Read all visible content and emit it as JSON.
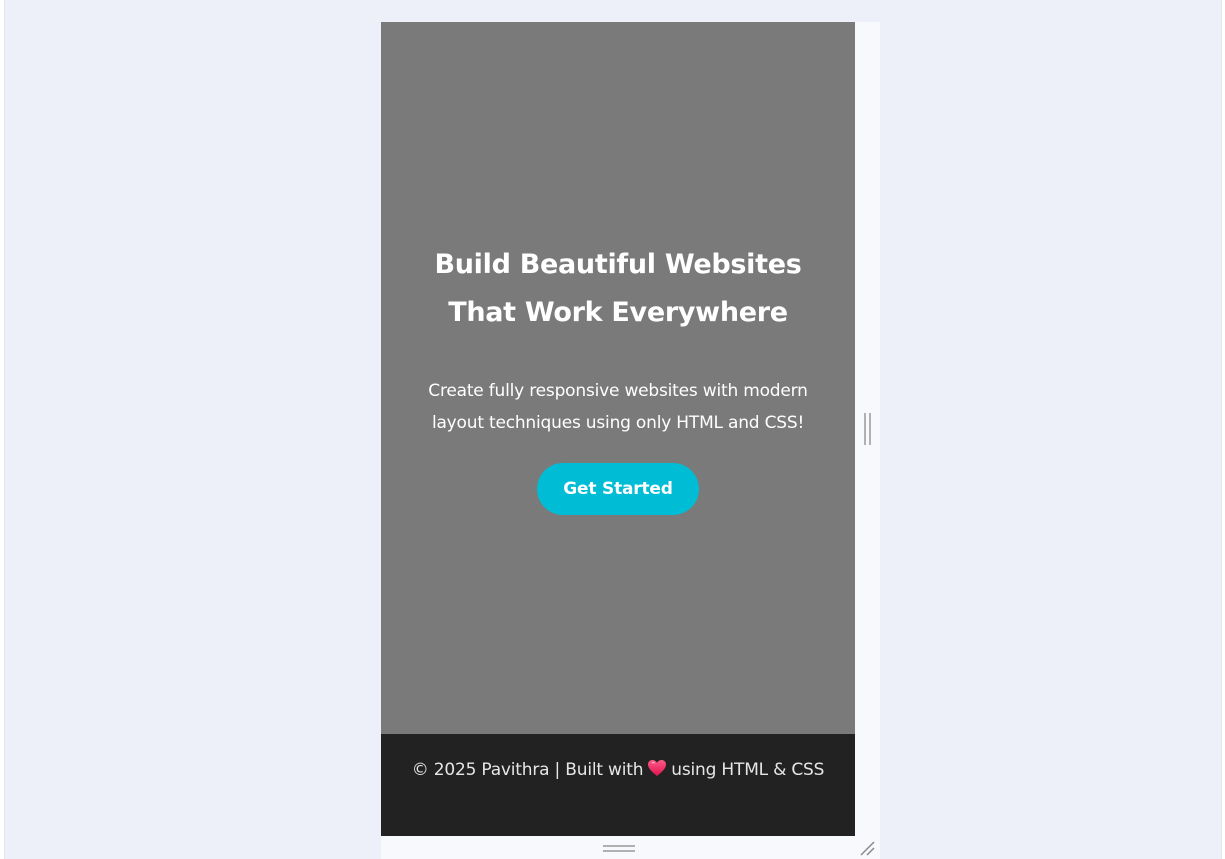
{
  "hero": {
    "title": "Build Beautiful Websites That Work Everywhere",
    "subtitle": "Create fully responsive websites with modern layout techniques using only HTML and CSS!",
    "cta_label": "Get Started"
  },
  "footer": {
    "text_before": "© 2025 Pavithra | Built with",
    "icon": "heart-icon",
    "text_after": "using HTML & CSS"
  },
  "colors": {
    "hero_bg": "#7a7a7a",
    "footer_bg": "#222222",
    "accent": "#00bcd4",
    "page_bg": "#edf0f8"
  }
}
